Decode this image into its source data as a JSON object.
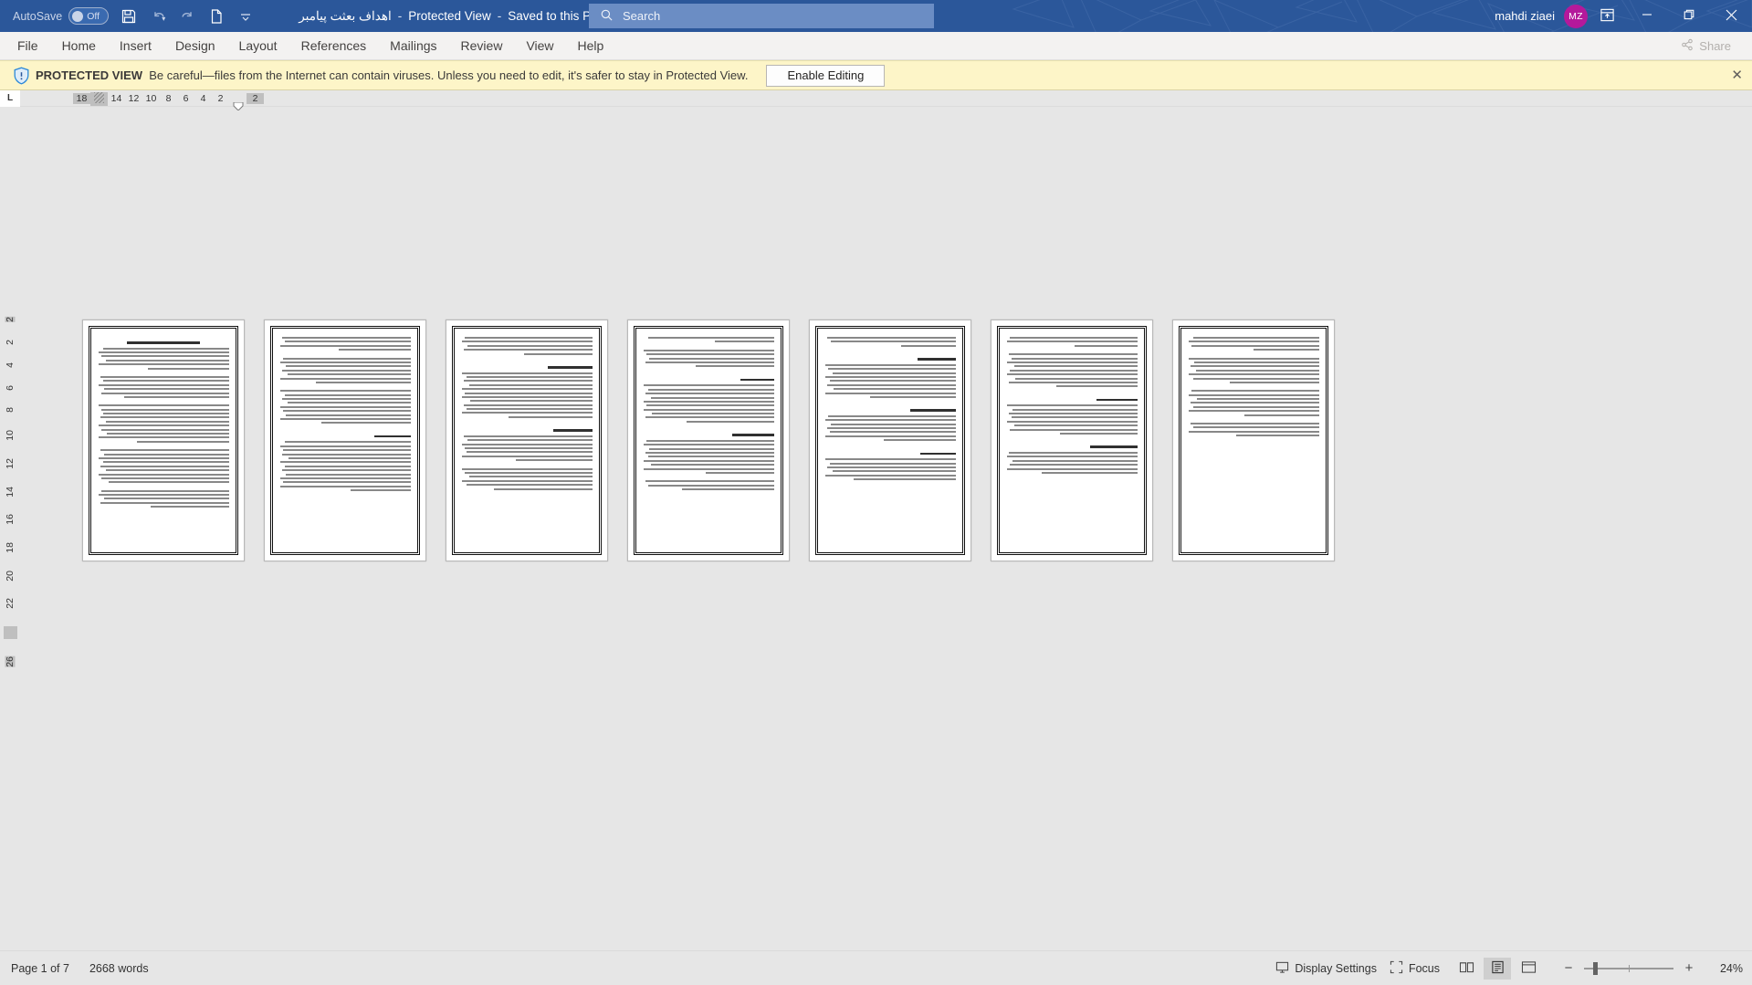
{
  "titlebar": {
    "autosave_label": "AutoSave",
    "autosave_state": "Off",
    "save_icon": "save-icon",
    "undo_icon": "undo-icon",
    "redo_icon": "redo-icon",
    "new_icon": "new-document-icon",
    "customize_qat_icon": "chevron-down-icon",
    "doc_name": "اهداف بعثت پیامبر",
    "protected_view_label": "Protected View",
    "saved_location": "Saved to this PC",
    "title_caret_icon": "chevron-down-icon",
    "search_placeholder": "Search",
    "search_icon": "search-icon",
    "account_name": "mahdi ziaei",
    "avatar_initials": "MZ",
    "ribbon_display_icon": "ribbon-display-options-icon",
    "minimize_icon": "minimize-icon",
    "restore_icon": "restore-icon",
    "close_icon": "close-icon",
    "accent_color": "#2b579a",
    "avatar_color": "#b4199b"
  },
  "ribbon": {
    "tabs": [
      {
        "label": "File",
        "active": false
      },
      {
        "label": "Home",
        "active": false
      },
      {
        "label": "Insert",
        "active": false
      },
      {
        "label": "Design",
        "active": false
      },
      {
        "label": "Layout",
        "active": false
      },
      {
        "label": "References",
        "active": false
      },
      {
        "label": "Mailings",
        "active": false
      },
      {
        "label": "Review",
        "active": false
      },
      {
        "label": "View",
        "active": false
      },
      {
        "label": "Help",
        "active": false
      }
    ],
    "share_label": "Share",
    "share_icon": "share-icon"
  },
  "protected_view": {
    "icon": "shield-info-icon",
    "title": "PROTECTED VIEW",
    "message": "Be careful—files from the Internet can contain viruses. Unless you need to edit, it's safer to stay in Protected View.",
    "enable_button": "Enable Editing",
    "close_icon": "close-icon",
    "background": "#fdf5c8"
  },
  "ruler": {
    "tabstop_marker": "L",
    "horizontal": [
      "18",
      "",
      "14",
      "12",
      "10",
      "8",
      "6",
      "4",
      "2",
      "",
      "2"
    ],
    "vertical": [
      "2",
      "2",
      "4",
      "6",
      "8",
      "10",
      "12",
      "14",
      "16",
      "18",
      "20",
      "22",
      "",
      "26"
    ]
  },
  "document": {
    "page_count_visible": 7,
    "pages": [
      {
        "has_border_frame": true,
        "heading": "اهداف بعثت پیامبر (ص)"
      },
      {
        "has_border_frame": true,
        "heading": ""
      },
      {
        "has_border_frame": true,
        "heading": ""
      },
      {
        "has_border_frame": true,
        "heading": ""
      },
      {
        "has_border_frame": true,
        "heading": ""
      },
      {
        "has_border_frame": true,
        "heading": ""
      },
      {
        "has_border_frame": true,
        "heading": ""
      }
    ]
  },
  "statusbar": {
    "page_indicator": "Page 1 of 7",
    "word_count": "2668 words",
    "display_settings_label": "Display Settings",
    "display_settings_icon": "display-settings-icon",
    "focus_label": "Focus",
    "focus_icon": "focus-icon",
    "view_read_icon": "read-mode-icon",
    "view_print_icon": "print-layout-icon",
    "view_web_icon": "web-layout-icon",
    "active_view": "print-layout-icon",
    "zoom_out_icon": "zoom-out-icon",
    "zoom_in_icon": "zoom-in-icon",
    "zoom_percent": "24%"
  }
}
